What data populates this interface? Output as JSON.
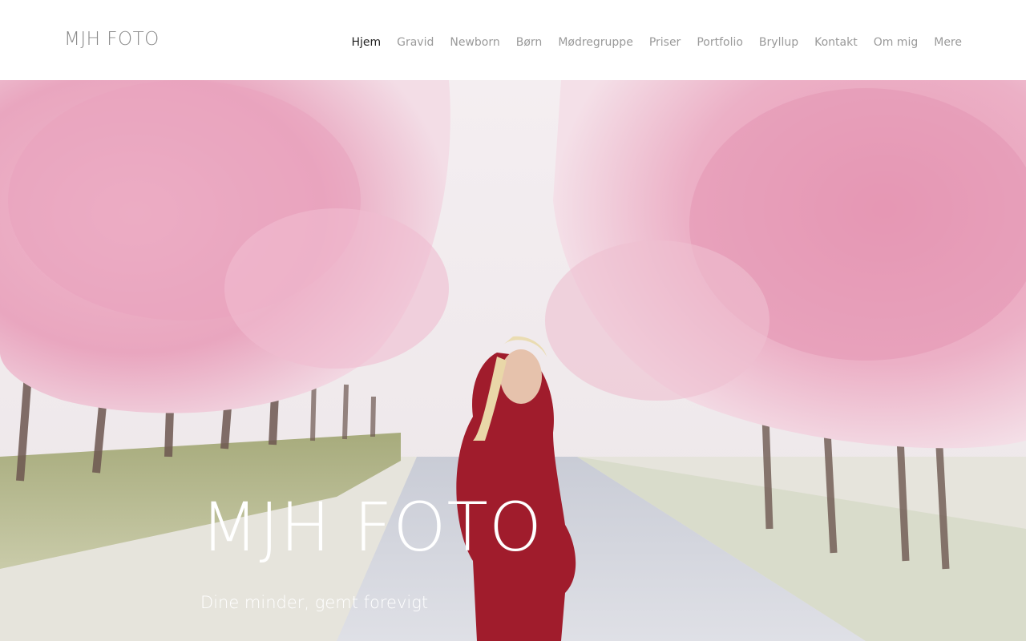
{
  "site": {
    "logo": "MJH FOTO"
  },
  "nav": {
    "items": [
      {
        "label": "Hjem",
        "active": true
      },
      {
        "label": "Gravid"
      },
      {
        "label": "Newborn"
      },
      {
        "label": "Børn"
      },
      {
        "label": "Mødregruppe"
      },
      {
        "label": "Priser"
      },
      {
        "label": "Portfolio"
      },
      {
        "label": "Bryllup"
      },
      {
        "label": "Kontakt"
      },
      {
        "label": "Om mig"
      },
      {
        "label": "Mere"
      }
    ]
  },
  "hero": {
    "title": "MJH FOTO",
    "subtitle": "Dine minder, gemt forevigt",
    "image": "maternity-photo-cherry-blossom-avenue"
  },
  "colors": {
    "nav_active": "#222222",
    "nav_inactive": "#9a9a9a",
    "logo": "#8a8a8a",
    "blossom": "#e8a9c0",
    "dress": "#a01c2c"
  }
}
